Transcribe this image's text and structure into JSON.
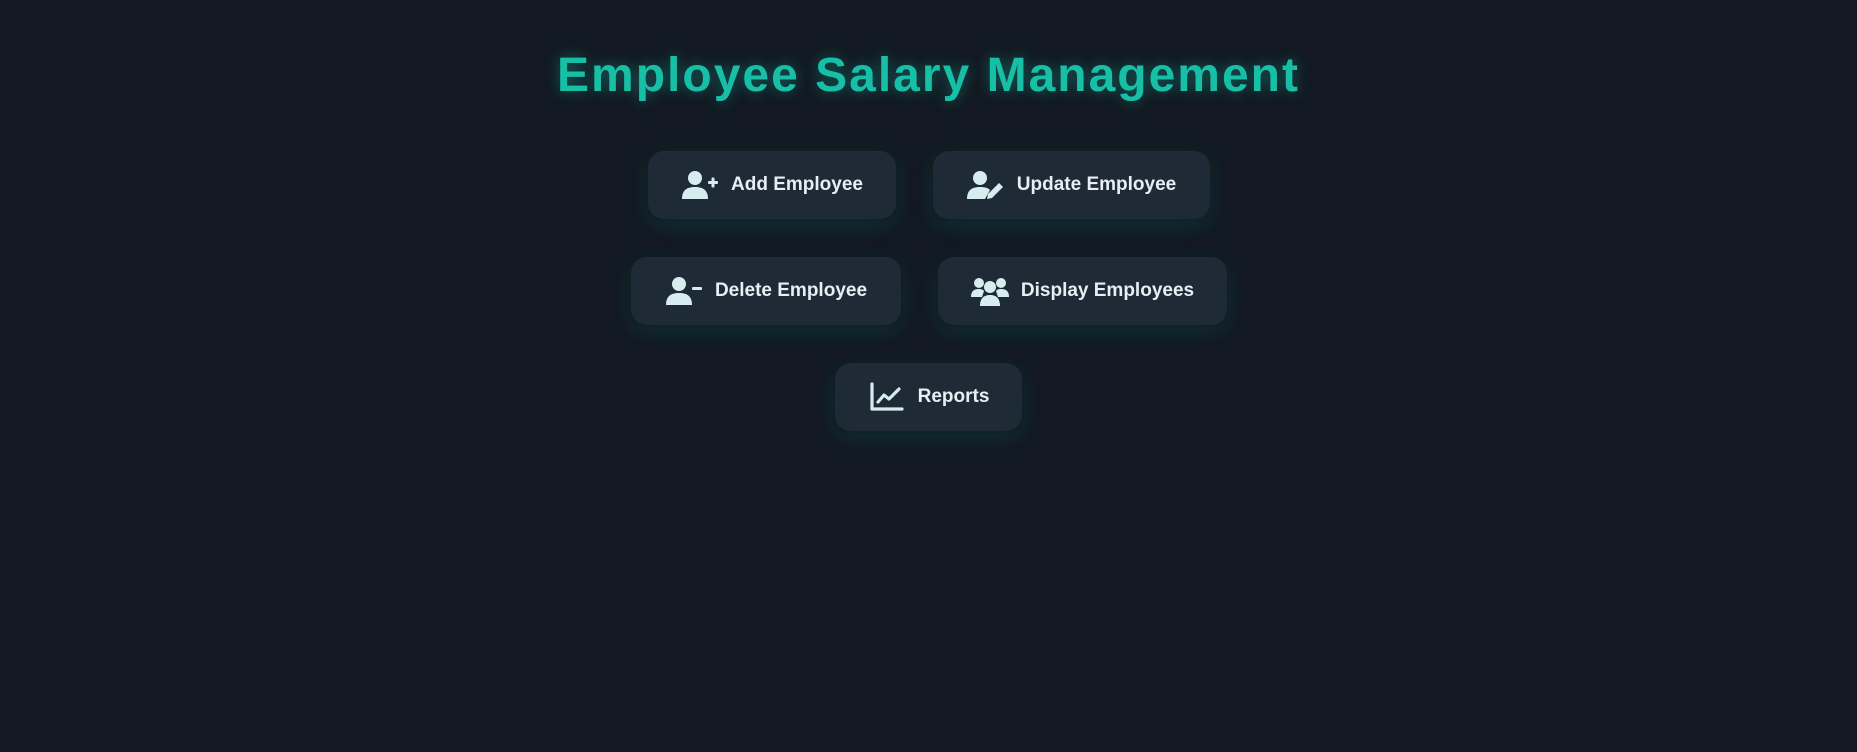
{
  "header": {
    "title": "Employee Salary Management"
  },
  "menu": {
    "items": [
      {
        "label": "Add Employee",
        "icon": "user-plus-icon"
      },
      {
        "label": "Update Employee",
        "icon": "user-edit-icon"
      },
      {
        "label": "Delete Employee",
        "icon": "user-minus-icon"
      },
      {
        "label": "Display Employees",
        "icon": "users-icon"
      },
      {
        "label": "Reports",
        "icon": "chart-line-icon"
      }
    ]
  },
  "colors": {
    "background": "#121922",
    "accent": "#17bfa6",
    "button_background": "#1e2a35",
    "button_text": "#e7eef4",
    "icon": "#d7ecef"
  }
}
